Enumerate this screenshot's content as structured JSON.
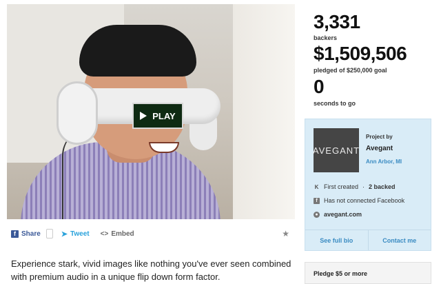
{
  "video": {
    "play_label": "PLAY"
  },
  "share_bar": {
    "facebook_icon": "f",
    "share_label": "Share",
    "tweet_label": "Tweet",
    "embed_icon": "<>",
    "embed_label": "Embed",
    "star_icon": "★"
  },
  "blurb": "Experience stark, vivid images like nothing you've ever seen combined with premium audio in a unique flip down form factor.",
  "stats": {
    "backers_count": "3,331",
    "backers_label": "backers",
    "pledged_amount": "$1,509,506",
    "pledged_label": "pledged of $250,000 goal",
    "time_value": "0",
    "time_label": "seconds to go"
  },
  "creator": {
    "logo_text": "AVEGANT",
    "project_by_label": "Project by",
    "name": "Avegant",
    "location": "Ann Arbor, MI",
    "first_created": "First created",
    "backed": "2 backed",
    "facebook_status": "Has not connected Facebook",
    "website": "avegant.com",
    "see_full_bio": "See full bio",
    "contact_me": "Contact me"
  },
  "reward": {
    "pledge_label": "Pledge $5 or more"
  }
}
